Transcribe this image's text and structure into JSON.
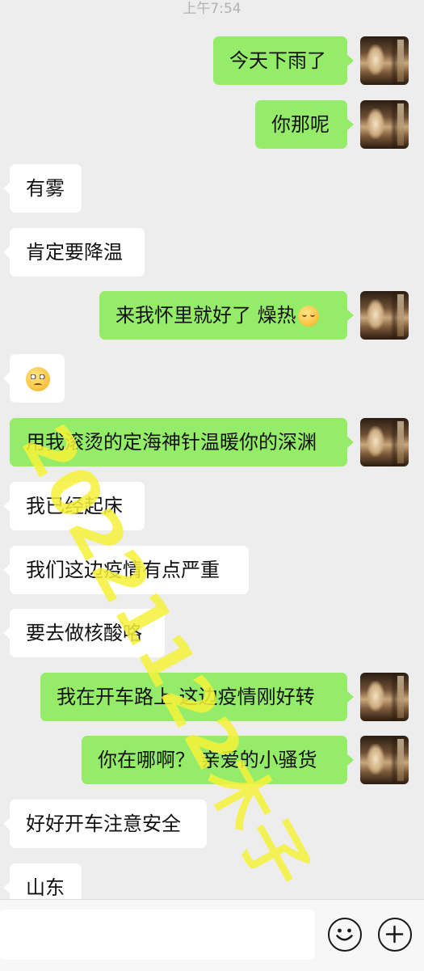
{
  "status": {
    "time": "上午7:54"
  },
  "messages": [
    {
      "side": "out",
      "text": "今天下雨了"
    },
    {
      "side": "out",
      "text": "你那呢"
    },
    {
      "side": "in",
      "text": "有雾"
    },
    {
      "side": "in",
      "text": "肯定要降温"
    },
    {
      "side": "out",
      "text": "来我怀里就好了 燥热",
      "emoji": "sleepy-face"
    },
    {
      "side": "in",
      "text": "",
      "emoji": "thinking-face"
    },
    {
      "side": "out",
      "text": "用我滚烫的定海神针温暖你的深渊"
    },
    {
      "side": "in",
      "text": "我已经起床"
    },
    {
      "side": "in",
      "text": "我们这边疫情有点严重"
    },
    {
      "side": "in",
      "text": "要去做核酸咯"
    },
    {
      "side": "out",
      "text": "我在开车路上 这边疫情刚好转"
    },
    {
      "side": "out",
      "text": "你在哪啊？ 亲爱的小骚货"
    },
    {
      "side": "in",
      "text": "好好开车注意安全"
    },
    {
      "side": "in",
      "text": "山东"
    }
  ],
  "watermark": "20221122木子",
  "composer": {
    "placeholder": "",
    "value": ""
  },
  "colors": {
    "background": "#ededed",
    "outgoing": "#95ec69",
    "incoming": "#ffffff",
    "watermark": "#f6f23a"
  },
  "icons": {
    "emoji_button": "smiley-icon",
    "more_button": "plus-icon"
  }
}
